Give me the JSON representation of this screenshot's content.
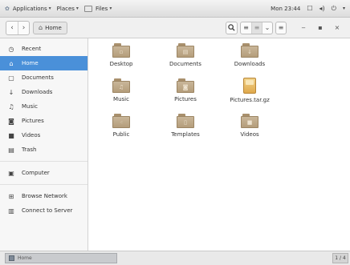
{
  "top_panel": {
    "applications_label": "Applications",
    "places_label": "Places",
    "files_label": "Files",
    "clock": "Mon 23:44",
    "icons": [
      "apps-icon",
      "screen-icon",
      "volume-icon",
      "power-icon"
    ]
  },
  "header_bar": {
    "back_glyph": "‹",
    "forward_glyph": "›",
    "path_label": "Home",
    "search_glyph": "🔍",
    "list_glyph": "≡",
    "grid_glyph": "≡",
    "sort_glyph": "⌄",
    "menu_glyph": "≡",
    "minimize_glyph": "‒",
    "maximize_glyph": "▪",
    "close_glyph": "×"
  },
  "sidebar": {
    "items": [
      {
        "label": "Recent",
        "icon": "clock-icon",
        "glyph": "◷"
      },
      {
        "label": "Home",
        "icon": "home-icon",
        "glyph": "⌂",
        "selected": true
      },
      {
        "label": "Documents",
        "icon": "document-icon",
        "glyph": "▢"
      },
      {
        "label": "Downloads",
        "icon": "download-icon",
        "glyph": "↓"
      },
      {
        "label": "Music",
        "icon": "music-icon",
        "glyph": "♫"
      },
      {
        "label": "Pictures",
        "icon": "camera-icon",
        "glyph": "◙"
      },
      {
        "label": "Videos",
        "icon": "video-icon",
        "glyph": "■"
      },
      {
        "label": "Trash",
        "icon": "trash-icon",
        "glyph": "▤"
      }
    ],
    "devices": [
      {
        "label": "Computer",
        "icon": "computer-icon",
        "glyph": "▣"
      }
    ],
    "network": [
      {
        "label": "Browse Network",
        "icon": "network-icon",
        "glyph": "⊞"
      },
      {
        "label": "Connect to Server",
        "icon": "server-icon",
        "glyph": "▥"
      }
    ]
  },
  "files": [
    {
      "name": "Desktop",
      "kind": "folder",
      "emblem": "▫"
    },
    {
      "name": "Documents",
      "kind": "folder",
      "emblem": "▤"
    },
    {
      "name": "Downloads",
      "kind": "folder",
      "emblem": "↓"
    },
    {
      "name": "Music",
      "kind": "folder",
      "emblem": "♫"
    },
    {
      "name": "Pictures",
      "kind": "folder",
      "emblem": "◙"
    },
    {
      "name": "Pictures.tar.gz",
      "kind": "archive",
      "emblem": ""
    },
    {
      "name": "Public",
      "kind": "folder",
      "emblem": "⁖"
    },
    {
      "name": "Templates",
      "kind": "folder",
      "emblem": "▯"
    },
    {
      "name": "Videos",
      "kind": "folder",
      "emblem": "■"
    }
  ],
  "taskbar": {
    "task_label": "Home",
    "workspace": "1 / 4"
  }
}
